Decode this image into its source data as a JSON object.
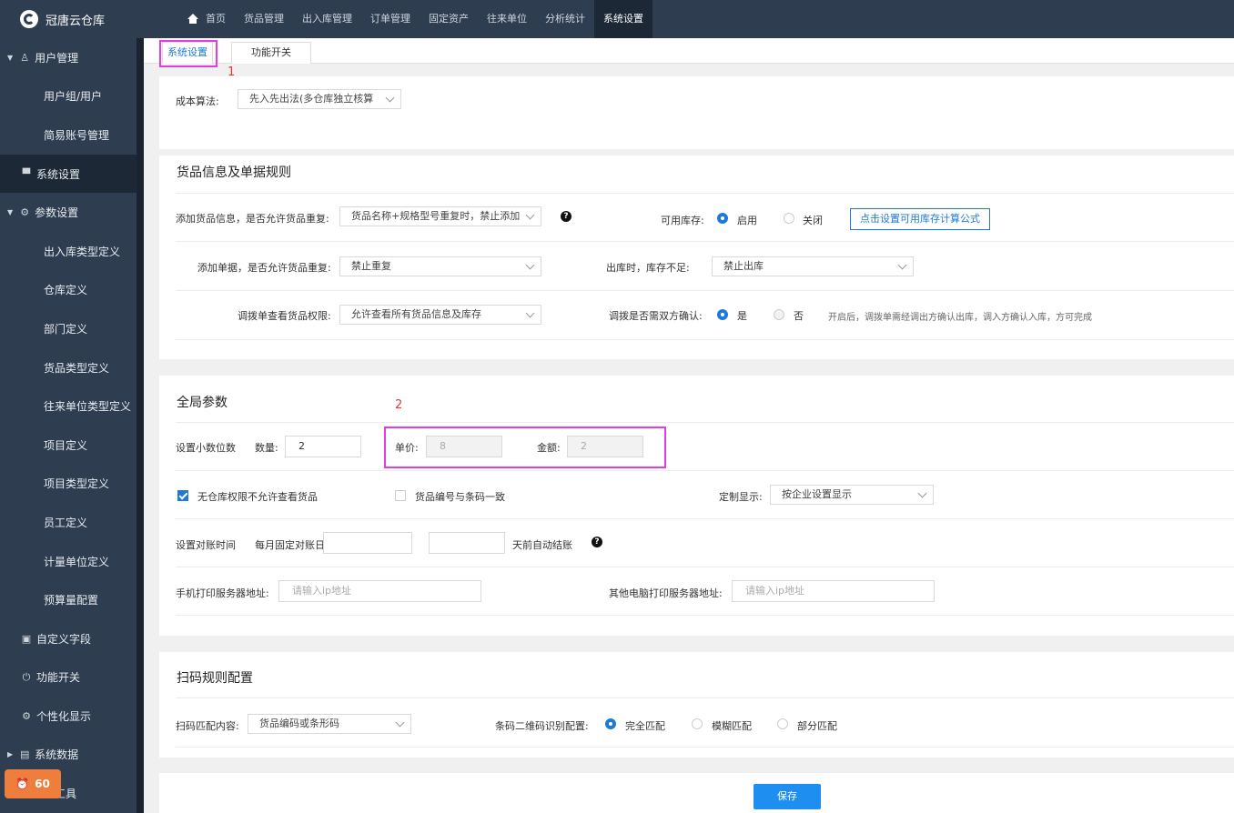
{
  "app": {
    "title": "冠唐云仓库"
  },
  "nav": [
    "首页",
    "货品管理",
    "出入库管理",
    "订单管理",
    "固定资产",
    "往来单位",
    "分析统计",
    "系统设置"
  ],
  "sidebar": {
    "items": [
      {
        "label": "用户管理",
        "level": 1,
        "arrow": "▼",
        "icon": "user-icon"
      },
      {
        "label": "用户组/用户",
        "level": 2
      },
      {
        "label": "简易账号管理",
        "level": 2
      },
      {
        "label": "系统设置",
        "level": 1,
        "icon": "monitor-icon",
        "active": true
      },
      {
        "label": "参数设置",
        "level": 1,
        "arrow": "▼",
        "icon": "gear-icon"
      },
      {
        "label": "出入库类型定义",
        "level": 2
      },
      {
        "label": "仓库定义",
        "level": 2
      },
      {
        "label": "部门定义",
        "level": 2
      },
      {
        "label": "货品类型定义",
        "level": 2
      },
      {
        "label": "往来单位类型定义",
        "level": 2
      },
      {
        "label": "项目定义",
        "level": 2
      },
      {
        "label": "项目类型定义",
        "level": 2
      },
      {
        "label": "员工定义",
        "level": 2
      },
      {
        "label": "计量单位定义",
        "level": 2
      },
      {
        "label": "预算量配置",
        "level": 2
      },
      {
        "label": "自定义字段",
        "level": 1,
        "icon": "form-icon"
      },
      {
        "label": "功能开关",
        "level": 1,
        "icon": "power-icon"
      },
      {
        "label": "个性化显示",
        "level": 1,
        "icon": "palette-icon"
      },
      {
        "label": "系统数据",
        "level": 1,
        "arrow": "▶",
        "icon": "database-icon"
      },
      {
        "label": "工具",
        "level": 2
      }
    ],
    "badge": "60"
  },
  "tabs": [
    "系统设置",
    "功能开关"
  ],
  "annotations": [
    "1",
    "2"
  ],
  "cost": {
    "label": "成本算法:",
    "value": "先入先出法(多仓库独立核算"
  },
  "goods": {
    "title": "货品信息及单据规则",
    "dup_goods_label": "添加货品信息，是否允许货品重复:",
    "dup_goods_value": "货品名称+规格型号重复时，禁止添加",
    "avail_stock_label": "可用库存:",
    "avail_on": "启用",
    "avail_off": "关闭",
    "formula_button": "点击设置可用库存计算公式",
    "dup_doc_label": "添加单据，是否允许货品重复:",
    "dup_doc_value": "禁止重复",
    "shortage_label": "出库时，库存不足:",
    "shortage_value": "禁止出库",
    "transfer_perm_label": "调拨单查看货品权限:",
    "transfer_perm_value": "允许查看所有货品信息及库存",
    "confirm_label": "调拨是否需双方确认:",
    "confirm_yes": "是",
    "confirm_no": "否",
    "confirm_note": "开启后，调拨单需经调出方确认出库，调入方确认入库，方可完成"
  },
  "global": {
    "title": "全局参数",
    "decimal_label": "设置小数位数",
    "qty_label": "数量:",
    "qty_value": "2",
    "price_label": "单价:",
    "price_value": "8",
    "amount_label": "金额:",
    "amount_value": "2",
    "no_wh_label": "无仓库权限不允许查看货品",
    "code_barcode_label": "货品编号与条码一致",
    "custom_display_label": "定制显示:",
    "custom_display_value": "按企业设置显示",
    "recon_label": "设置对账时间",
    "recon_day_label": "每月固定对账日:",
    "auto_settle_label": "天前自动结账",
    "mobile_print_label": "手机打印服务器地址:",
    "mobile_print_placeholder": "请输入ip地址",
    "pc_print_label": "其他电脑打印服务器地址:",
    "pc_print_placeholder": "请输入ip地址"
  },
  "scan": {
    "title": "扫码规则配置",
    "match_label": "扫码匹配内容:",
    "match_value": "货品编码或条形码",
    "recognize_label": "条码二维码识别配置:",
    "opt_exact": "完全匹配",
    "opt_fuzzy": "模糊匹配",
    "opt_partial": "部分匹配"
  },
  "save_label": "保存",
  "colors": {
    "sidebar": "#2e3d4f",
    "accent": "#1e7ad6",
    "highlight": "#e53ce0",
    "badge": "#ef7d3c"
  }
}
